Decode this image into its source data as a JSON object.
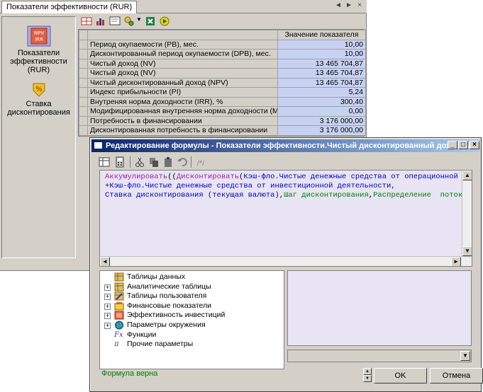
{
  "background_window": {
    "tab_title": "Показатели эффективности (RUR)",
    "tab_controls": [
      "◄",
      "►",
      "×"
    ],
    "sidebar": {
      "items": [
        {
          "label": "Показатели эффективности (RUR)",
          "icon": "npv-irr-icon"
        },
        {
          "label": "Ставка дисконтирования",
          "icon": "percent-icon"
        }
      ]
    },
    "toolbar_icons": [
      "grid-icon",
      "chart-icon",
      "note-icon",
      "settings-icon",
      "dropdown-icon",
      "excel-export-icon",
      "run-icon"
    ],
    "grid": {
      "column_header": "Значение показателя",
      "rows": [
        {
          "name": "Период окупаемости (PB), мес.",
          "value": "10,00"
        },
        {
          "name": "Дисконтированный период окупаемости (DPB), мес.",
          "value": "10,00"
        },
        {
          "name": "Чистый доход (NV)",
          "value": "13 465 704,87"
        },
        {
          "name": "Чистый доход (NV)",
          "value": "13 465 704,87"
        },
        {
          "name": "Чистый дисконтированный доход (NPV)",
          "value": "13 465 704,87"
        },
        {
          "name": "Индекс прибыльности (PI)",
          "value": "5,24"
        },
        {
          "name": "Внутреняя норма доходности (IRR), %",
          "value": "300,40"
        },
        {
          "name": "Модифицированная внутренняя норма доходности (MIRR), %",
          "value": "0,00"
        },
        {
          "name": "Потребность в финансировании",
          "value": "3 176 000,00"
        },
        {
          "name": "Дисконтированная потребность в финансировании",
          "value": "3 176 000,00"
        }
      ]
    }
  },
  "dialog": {
    "title": "Редактирование формулы - Показатели эффективности.Чистый дисконтированный доход (NPV)",
    "caption_buttons": [
      "_",
      "□",
      "×"
    ],
    "toolbar_icons": [
      "table-icon",
      "calculator-icon",
      "cut-icon",
      "copy-icon",
      "paste-icon",
      "undo-icon",
      "comment-icon"
    ],
    "formula": {
      "line1": {
        "fn1": "Аккумулировать",
        "p1": "((",
        "fn2": "Дисконтировать",
        "p2": "(",
        "ref1": "Кэш-фло.Чистые денежные средства от операционной деяте"
      },
      "line2": {
        "op": "+",
        "ref": "Кэш-фло.Чистые денежные средства от инвестиционной деятельности,"
      },
      "line3": {
        "ref": "Ставка дисконтирования (текущая валюта)",
        "sep1": ",",
        "arg1": "Шаг дисконтирования",
        "sep2": ",",
        "arg2": "Распределение  потока",
        "close": "))"
      }
    },
    "tree": [
      {
        "label": "Таблицы данных",
        "icon": "table-icon",
        "expandable": false
      },
      {
        "label": "Аналитические таблицы",
        "icon": "analytic-table-icon",
        "expandable": true
      },
      {
        "label": "Таблицы пользователя",
        "icon": "user-table-icon",
        "expandable": true
      },
      {
        "label": "Финансовые показатели",
        "icon": "finance-icon",
        "expandable": true
      },
      {
        "label": "Эффективность инвестиций",
        "icon": "investment-icon",
        "expandable": true
      },
      {
        "label": "Параметры окружения",
        "icon": "globe-icon",
        "expandable": true
      },
      {
        "label": "Функции",
        "icon": "function-icon",
        "expandable": false,
        "glyph": "Fx"
      },
      {
        "label": "Прочие параметры",
        "icon": "pi-icon",
        "expandable": false,
        "glyph": "π"
      }
    ],
    "status": "Формула верна",
    "ok_label": "OK",
    "cancel_label": "Отмена",
    "colors": {
      "function": "#a020a0",
      "reference": "#0000c0",
      "argument": "#008000",
      "status": "#008000",
      "title_gradient_start": "#0a246a",
      "title_gradient_end": "#a6caf0"
    }
  }
}
